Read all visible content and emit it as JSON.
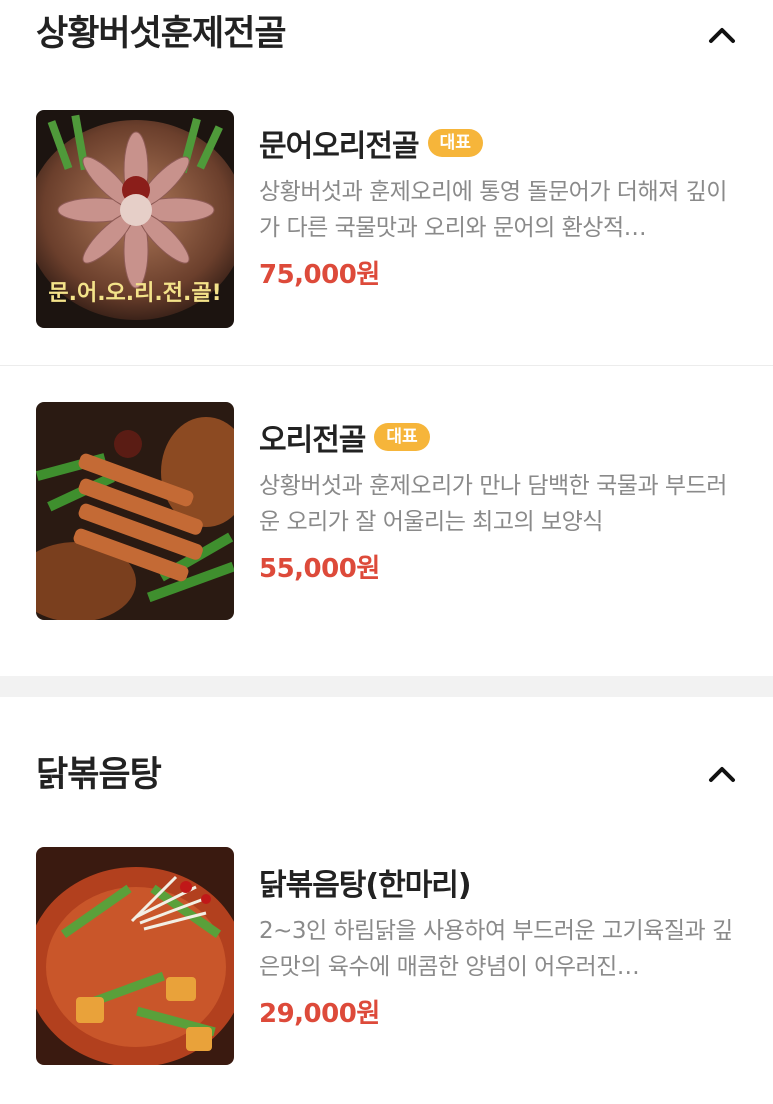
{
  "sections": [
    {
      "title": "상황버섯훈제전골",
      "items": [
        {
          "name": "문어오리전골",
          "badge": "대표",
          "description": "상황버섯과 훈제오리에 통영 돌문어가 더해져 깊이가 다른 국물맛과 오리와 문어의 환상적…",
          "price": "75,000원",
          "image_caption": "문.어.오.리.전.골!"
        },
        {
          "name": "오리전골",
          "badge": "대표",
          "description": "상황버섯과 훈제오리가 만나 담백한 국물과 부드러운 오리가 잘 어울리는 최고의 보양식",
          "price": "55,000원"
        }
      ]
    },
    {
      "title": "닭볶음탕",
      "items": [
        {
          "name": "닭볶음탕(한마리)",
          "description": "2~3인 하림닭을 사용하여 부드러운 고기육질과 깊은맛의 육수에 매콤한 양념이 어우러진…",
          "price": "29,000원"
        }
      ]
    }
  ],
  "icons": {
    "collapse": "chevron-up-icon"
  },
  "colors": {
    "price": "#dd4a3a",
    "badge": "#f6b53a",
    "divider": "#f2f2f2"
  }
}
